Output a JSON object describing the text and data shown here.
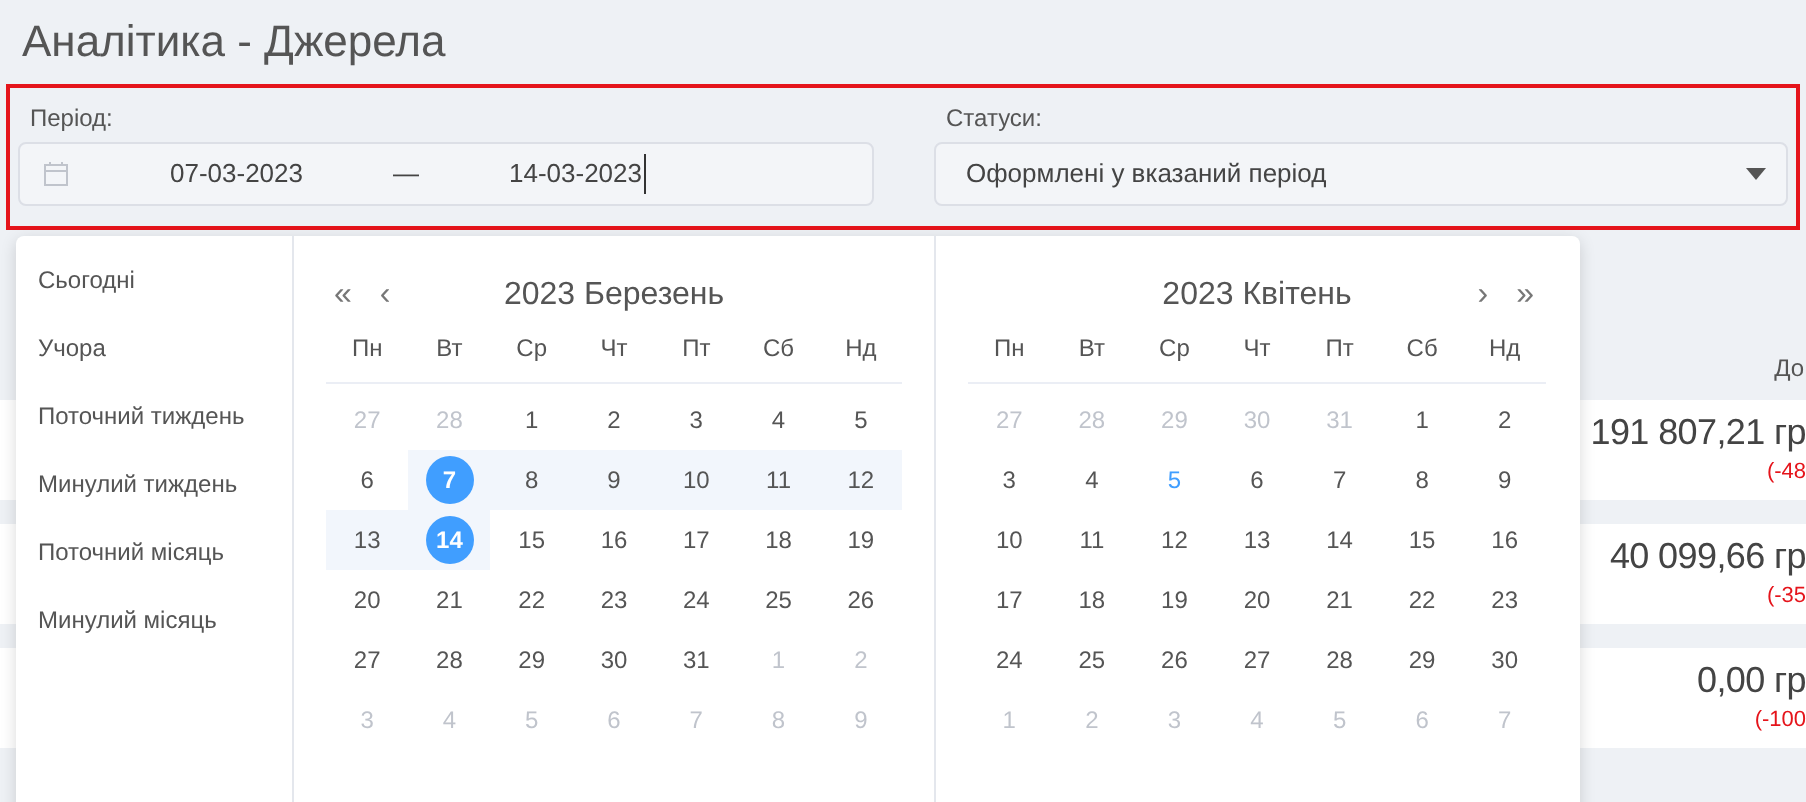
{
  "page_title": "Аналітика - Джерела",
  "filters": {
    "period_label": "Період:",
    "date_from": "07-03-2023",
    "separator": "—",
    "date_to": "14-03-2023",
    "status_label": "Статуси:",
    "status_value": "Оформлені у вказаний період"
  },
  "shortcuts": [
    "Сьогодні",
    "Учора",
    "Поточний тиждень",
    "Минулий тиждень",
    "Поточний місяць",
    "Минулий місяць"
  ],
  "calendars": [
    {
      "title": "2023 Березень",
      "nav_prev": [
        "«",
        "‹"
      ],
      "weekdays": [
        "Пн",
        "Вт",
        "Ср",
        "Чт",
        "Пт",
        "Сб",
        "Нд"
      ],
      "weeks": [
        [
          {
            "text": "27",
            "kind": "muted",
            "selected": false,
            "in_range": false
          },
          {
            "text": "28",
            "kind": "muted",
            "selected": false,
            "in_range": false
          },
          {
            "text": "1",
            "kind": "normal",
            "selected": false,
            "in_range": false
          },
          {
            "text": "2",
            "kind": "normal",
            "selected": false,
            "in_range": false
          },
          {
            "text": "3",
            "kind": "normal",
            "selected": false,
            "in_range": false
          },
          {
            "text": "4",
            "kind": "normal",
            "selected": false,
            "in_range": false
          },
          {
            "text": "5",
            "kind": "normal",
            "selected": false,
            "in_range": false
          }
        ],
        [
          {
            "text": "6",
            "kind": "normal",
            "selected": false,
            "in_range": false
          },
          {
            "text": "7",
            "kind": "normal",
            "selected": true,
            "in_range": true
          },
          {
            "text": "8",
            "kind": "normal",
            "selected": false,
            "in_range": true
          },
          {
            "text": "9",
            "kind": "normal",
            "selected": false,
            "in_range": true
          },
          {
            "text": "10",
            "kind": "normal",
            "selected": false,
            "in_range": true
          },
          {
            "text": "11",
            "kind": "normal",
            "selected": false,
            "in_range": true
          },
          {
            "text": "12",
            "kind": "normal",
            "selected": false,
            "in_range": true
          }
        ],
        [
          {
            "text": "13",
            "kind": "normal",
            "selected": false,
            "in_range": true
          },
          {
            "text": "14",
            "kind": "normal",
            "selected": true,
            "in_range": true
          },
          {
            "text": "15",
            "kind": "normal",
            "selected": false,
            "in_range": false
          },
          {
            "text": "16",
            "kind": "normal",
            "selected": false,
            "in_range": false
          },
          {
            "text": "17",
            "kind": "normal",
            "selected": false,
            "in_range": false
          },
          {
            "text": "18",
            "kind": "normal",
            "selected": false,
            "in_range": false
          },
          {
            "text": "19",
            "kind": "normal",
            "selected": false,
            "in_range": false
          }
        ],
        [
          {
            "text": "20",
            "kind": "normal",
            "selected": false,
            "in_range": false
          },
          {
            "text": "21",
            "kind": "normal",
            "selected": false,
            "in_range": false
          },
          {
            "text": "22",
            "kind": "normal",
            "selected": false,
            "in_range": false
          },
          {
            "text": "23",
            "kind": "normal",
            "selected": false,
            "in_range": false
          },
          {
            "text": "24",
            "kind": "normal",
            "selected": false,
            "in_range": false
          },
          {
            "text": "25",
            "kind": "normal",
            "selected": false,
            "in_range": false
          },
          {
            "text": "26",
            "kind": "normal",
            "selected": false,
            "in_range": false
          }
        ],
        [
          {
            "text": "27",
            "kind": "normal",
            "selected": false,
            "in_range": false
          },
          {
            "text": "28",
            "kind": "normal",
            "selected": false,
            "in_range": false
          },
          {
            "text": "29",
            "kind": "normal",
            "selected": false,
            "in_range": false
          },
          {
            "text": "30",
            "kind": "normal",
            "selected": false,
            "in_range": false
          },
          {
            "text": "31",
            "kind": "normal",
            "selected": false,
            "in_range": false
          },
          {
            "text": "1",
            "kind": "muted",
            "selected": false,
            "in_range": false
          },
          {
            "text": "2",
            "kind": "muted",
            "selected": false,
            "in_range": false
          }
        ],
        [
          {
            "text": "3",
            "kind": "muted",
            "selected": false,
            "in_range": false
          },
          {
            "text": "4",
            "kind": "muted",
            "selected": false,
            "in_range": false
          },
          {
            "text": "5",
            "kind": "muted",
            "selected": false,
            "in_range": false
          },
          {
            "text": "6",
            "kind": "muted",
            "selected": false,
            "in_range": false
          },
          {
            "text": "7",
            "kind": "muted",
            "selected": false,
            "in_range": false
          },
          {
            "text": "8",
            "kind": "muted",
            "selected": false,
            "in_range": false
          },
          {
            "text": "9",
            "kind": "muted",
            "selected": false,
            "in_range": false
          }
        ]
      ]
    },
    {
      "title": "2023 Квітень",
      "nav_next": [
        "›",
        "»"
      ],
      "weekdays": [
        "Пн",
        "Вт",
        "Ср",
        "Чт",
        "Пт",
        "Сб",
        "Нд"
      ],
      "weeks": [
        [
          {
            "text": "27",
            "kind": "muted",
            "selected": false,
            "in_range": false
          },
          {
            "text": "28",
            "kind": "muted",
            "selected": false,
            "in_range": false
          },
          {
            "text": "29",
            "kind": "muted",
            "selected": false,
            "in_range": false
          },
          {
            "text": "30",
            "kind": "muted",
            "selected": false,
            "in_range": false
          },
          {
            "text": "31",
            "kind": "muted",
            "selected": false,
            "in_range": false
          },
          {
            "text": "1",
            "kind": "normal",
            "selected": false,
            "in_range": false
          },
          {
            "text": "2",
            "kind": "normal",
            "selected": false,
            "in_range": false
          }
        ],
        [
          {
            "text": "3",
            "kind": "normal",
            "selected": false,
            "in_range": false
          },
          {
            "text": "4",
            "kind": "normal",
            "selected": false,
            "in_range": false
          },
          {
            "text": "5",
            "kind": "today",
            "selected": false,
            "in_range": false
          },
          {
            "text": "6",
            "kind": "normal",
            "selected": false,
            "in_range": false
          },
          {
            "text": "7",
            "kind": "normal",
            "selected": false,
            "in_range": false
          },
          {
            "text": "8",
            "kind": "normal",
            "selected": false,
            "in_range": false
          },
          {
            "text": "9",
            "kind": "normal",
            "selected": false,
            "in_range": false
          }
        ],
        [
          {
            "text": "10",
            "kind": "normal",
            "selected": false,
            "in_range": false
          },
          {
            "text": "11",
            "kind": "normal",
            "selected": false,
            "in_range": false
          },
          {
            "text": "12",
            "kind": "normal",
            "selected": false,
            "in_range": false
          },
          {
            "text": "13",
            "kind": "normal",
            "selected": false,
            "in_range": false
          },
          {
            "text": "14",
            "kind": "normal",
            "selected": false,
            "in_range": false
          },
          {
            "text": "15",
            "kind": "normal",
            "selected": false,
            "in_range": false
          },
          {
            "text": "16",
            "kind": "normal",
            "selected": false,
            "in_range": false
          }
        ],
        [
          {
            "text": "17",
            "kind": "normal",
            "selected": false,
            "in_range": false
          },
          {
            "text": "18",
            "kind": "normal",
            "selected": false,
            "in_range": false
          },
          {
            "text": "19",
            "kind": "normal",
            "selected": false,
            "in_range": false
          },
          {
            "text": "20",
            "kind": "normal",
            "selected": false,
            "in_range": false
          },
          {
            "text": "21",
            "kind": "normal",
            "selected": false,
            "in_range": false
          },
          {
            "text": "22",
            "kind": "normal",
            "selected": false,
            "in_range": false
          },
          {
            "text": "23",
            "kind": "normal",
            "selected": false,
            "in_range": false
          }
        ],
        [
          {
            "text": "24",
            "kind": "normal",
            "selected": false,
            "in_range": false
          },
          {
            "text": "25",
            "kind": "normal",
            "selected": false,
            "in_range": false
          },
          {
            "text": "26",
            "kind": "normal",
            "selected": false,
            "in_range": false
          },
          {
            "text": "27",
            "kind": "normal",
            "selected": false,
            "in_range": false
          },
          {
            "text": "28",
            "kind": "normal",
            "selected": false,
            "in_range": false
          },
          {
            "text": "29",
            "kind": "normal",
            "selected": false,
            "in_range": false
          },
          {
            "text": "30",
            "kind": "normal",
            "selected": false,
            "in_range": false
          }
        ],
        [
          {
            "text": "1",
            "kind": "muted",
            "selected": false,
            "in_range": false
          },
          {
            "text": "2",
            "kind": "muted",
            "selected": false,
            "in_range": false
          },
          {
            "text": "3",
            "kind": "muted",
            "selected": false,
            "in_range": false
          },
          {
            "text": "4",
            "kind": "muted",
            "selected": false,
            "in_range": false
          },
          {
            "text": "5",
            "kind": "muted",
            "selected": false,
            "in_range": false
          },
          {
            "text": "6",
            "kind": "muted",
            "selected": false,
            "in_range": false
          },
          {
            "text": "7",
            "kind": "muted",
            "selected": false,
            "in_range": false
          }
        ]
      ]
    }
  ],
  "table": {
    "column_heading": "До",
    "rows": [
      {
        "amount": "191 807,21 гр",
        "change": "(-48"
      },
      {
        "amount": "40 099,66 гр",
        "change": "(-35"
      },
      {
        "amount": "0,00 гр",
        "change": "(-100"
      }
    ]
  }
}
